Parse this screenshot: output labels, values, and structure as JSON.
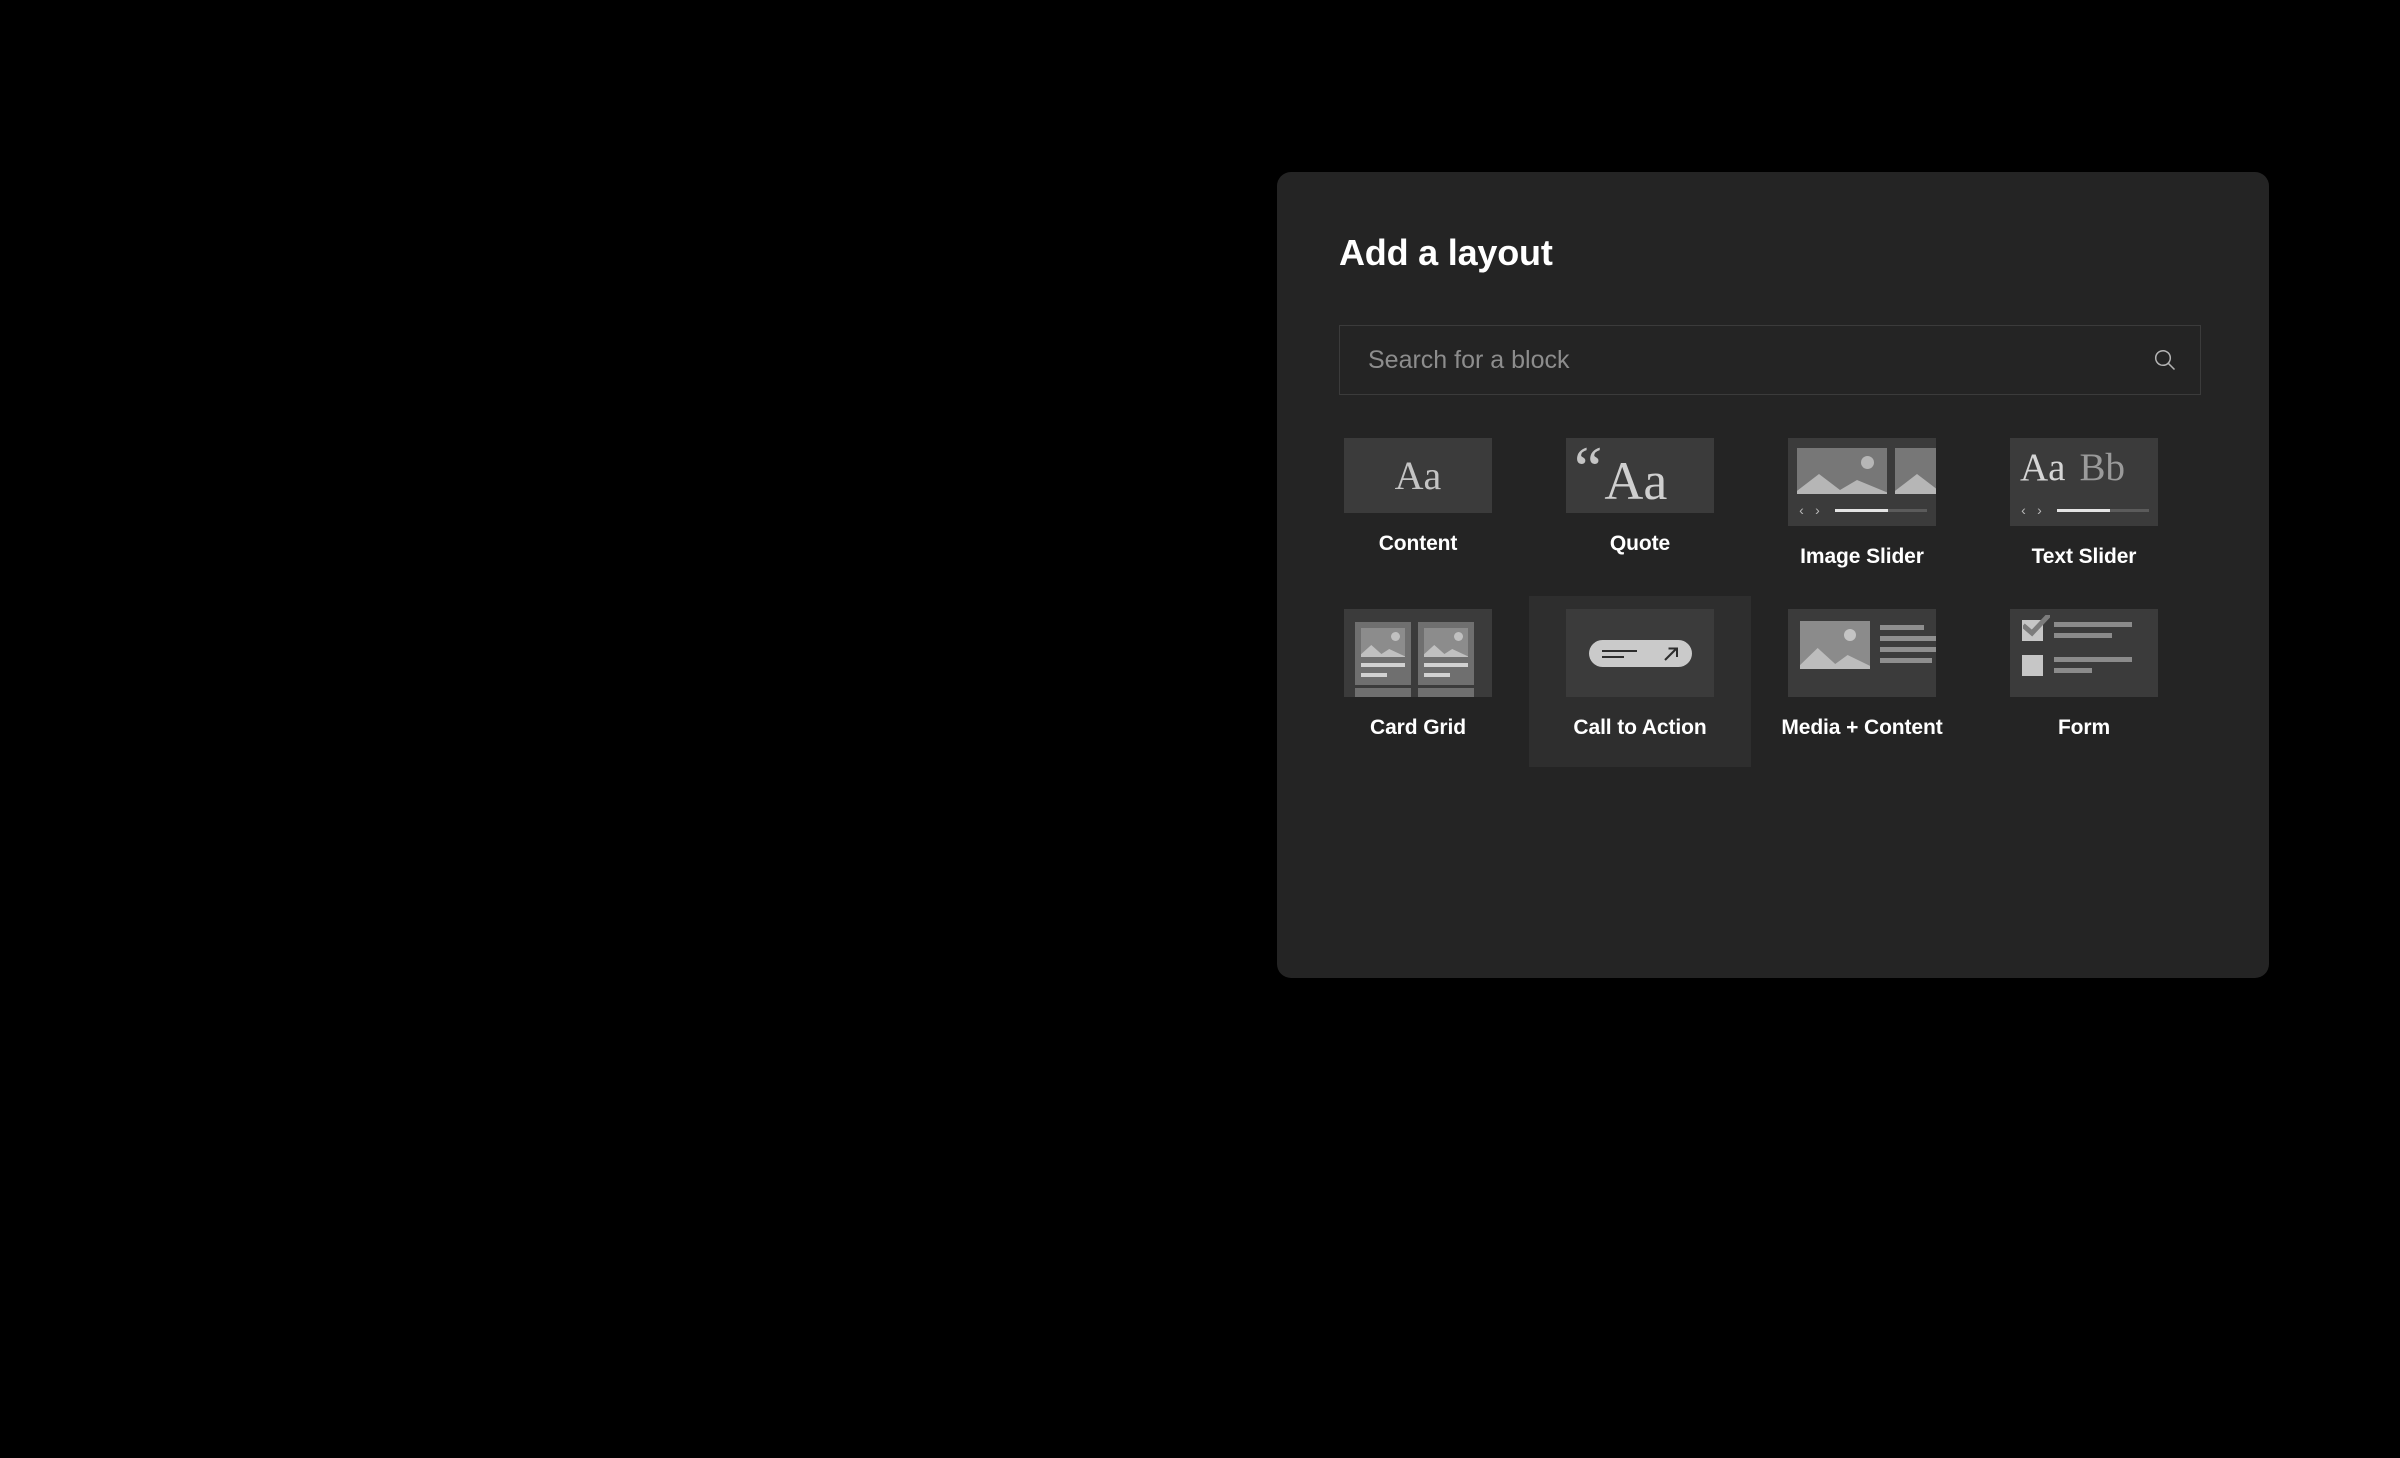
{
  "panel": {
    "title": "Add a layout"
  },
  "search": {
    "placeholder": "Search for a block",
    "value": "",
    "icon": "search-icon"
  },
  "colors": {
    "page_background": "#000000",
    "panel_background": "#242424",
    "thumbnail_background": "#3b3b3b",
    "tile_hover_background": "#2e2e2e",
    "label_text": "#ffffff",
    "placeholder_text": "#8d8d8d",
    "input_border": "#3b3b3b"
  },
  "blocks": {
    "rows": [
      [
        {
          "label": "Content",
          "thumb": "content-thumbnail",
          "hovered": false,
          "sample_text": "Aa"
        },
        {
          "label": "Quote",
          "thumb": "quote-thumbnail",
          "hovered": false,
          "sample_text": "Aa",
          "quote_glyph": "“"
        },
        {
          "label": "Image Slider",
          "thumb": "image-slider-thumbnail",
          "hovered": false,
          "prev_glyph": "‹",
          "next_glyph": "›",
          "progress": 58
        },
        {
          "label": "Text Slider",
          "thumb": "text-slider-thumbnail",
          "hovered": false,
          "prev_glyph": "‹",
          "next_glyph": "›",
          "progress": 58,
          "sample_a": "Aa",
          "sample_b": "Bb"
        }
      ],
      [
        {
          "label": "Card Grid",
          "thumb": "card-grid-thumbnail",
          "hovered": false
        },
        {
          "label": "Call to Action",
          "thumb": "call-to-action-thumbnail",
          "hovered": true
        },
        {
          "label": "Media + Content",
          "thumb": "media-content-thumbnail",
          "hovered": false
        },
        {
          "label": "Form",
          "thumb": "form-thumbnail",
          "hovered": false
        }
      ]
    ]
  }
}
